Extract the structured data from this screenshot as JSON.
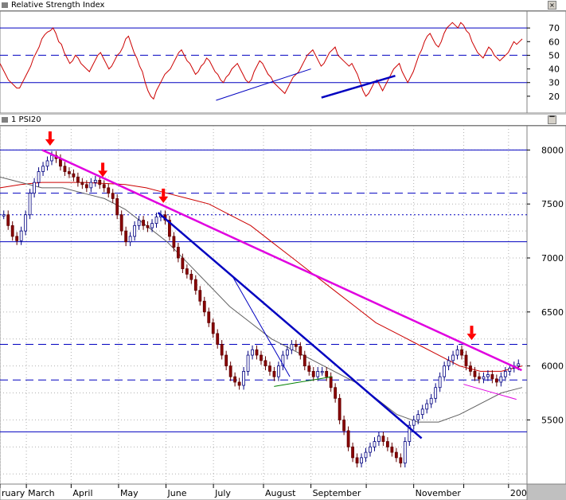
{
  "panes": {
    "rsi": {
      "title": "Relative Strength Index"
    },
    "price": {
      "title": "1 PSI20"
    }
  },
  "chart_data": [
    {
      "type": "line",
      "title": "Relative Strength Index",
      "ylim": [
        10,
        80
      ],
      "yticks": [
        20,
        30,
        40,
        50,
        60,
        70
      ],
      "hlines": [
        {
          "value": 70,
          "style": "solid",
          "color": "#0000c0"
        },
        {
          "value": 50,
          "style": "dashed",
          "color": "#0000c0"
        },
        {
          "value": 30,
          "style": "solid",
          "color": "#0000c0"
        }
      ],
      "series": [
        {
          "color": "#cc0000",
          "values": [
            44,
            40,
            36,
            32,
            30,
            28,
            26,
            26,
            30,
            34,
            38,
            42,
            48,
            52,
            56,
            62,
            65,
            67,
            68,
            70,
            66,
            60,
            58,
            52,
            48,
            44,
            46,
            50,
            48,
            44,
            42,
            40,
            38,
            42,
            46,
            50,
            52,
            48,
            44,
            40,
            42,
            46,
            50,
            52,
            56,
            62,
            64,
            58,
            52,
            48,
            42,
            38,
            30,
            24,
            20,
            18,
            24,
            28,
            32,
            36,
            38,
            40,
            44,
            48,
            52,
            54,
            50,
            46,
            44,
            40,
            36,
            38,
            42,
            44,
            48,
            46,
            42,
            38,
            36,
            32,
            30,
            34,
            36,
            40,
            42,
            44,
            40,
            36,
            32,
            30,
            32,
            38,
            42,
            46,
            44,
            40,
            36,
            34,
            30,
            28,
            26,
            24,
            22,
            26,
            30,
            34,
            36,
            38,
            42,
            46,
            50,
            52,
            54,
            50,
            46,
            42,
            44,
            48,
            52,
            54,
            56,
            50,
            48,
            46,
            44,
            42,
            44,
            40,
            36,
            30,
            24,
            20,
            22,
            26,
            30,
            32,
            28,
            24,
            28,
            32,
            36,
            40,
            42,
            44,
            38,
            34,
            30,
            34,
            38,
            44,
            50,
            54,
            60,
            64,
            66,
            62,
            58,
            56,
            60,
            66,
            70,
            72,
            74,
            72,
            70,
            74,
            72,
            68,
            66,
            60,
            56,
            52,
            50,
            48,
            52,
            56,
            54,
            50,
            48,
            46,
            48,
            50,
            52,
            56,
            60,
            58,
            60,
            62
          ]
        }
      ],
      "annotations": [
        {
          "kind": "trendline",
          "color": "#0000c0",
          "width": 1,
          "from": [
            0.41,
            17
          ],
          "to": [
            0.59,
            40
          ]
        },
        {
          "kind": "trendline",
          "color": "#0000c0",
          "width": 2.5,
          "from": [
            0.61,
            19
          ],
          "to": [
            0.75,
            35
          ]
        }
      ]
    },
    {
      "type": "candlestick",
      "title": "1 PSI20",
      "ylim": [
        4950,
        8180
      ],
      "yticks": [
        5500,
        6000,
        6500,
        7000,
        7500,
        8000
      ],
      "xticks": [
        "ruary",
        "March",
        "April",
        "May",
        "June",
        "July",
        "August",
        "September",
        "",
        "November",
        "",
        "200"
      ],
      "close": [
        7400,
        7300,
        7200,
        7160,
        7250,
        7400,
        7600,
        7700,
        7800,
        7850,
        7900,
        7950,
        7920,
        7850,
        7800,
        7780,
        7750,
        7700,
        7680,
        7650,
        7700,
        7720,
        7680,
        7650,
        7600,
        7550,
        7400,
        7250,
        7150,
        7200,
        7300,
        7350,
        7300,
        7280,
        7320,
        7380,
        7400,
        7350,
        7200,
        7100,
        7000,
        6900,
        6850,
        6800,
        6700,
        6600,
        6500,
        6400,
        6300,
        6200,
        6100,
        6000,
        5900,
        5850,
        5820,
        5950,
        6100,
        6150,
        6100,
        6050,
        6000,
        5950,
        5900,
        6000,
        6100,
        6150,
        6200,
        6180,
        6100,
        6000,
        5950,
        5900,
        5950,
        5950,
        5900,
        5800,
        5700,
        5500,
        5400,
        5250,
        5150,
        5100,
        5150,
        5200,
        5250,
        5300,
        5350,
        5300,
        5250,
        5200,
        5150,
        5100,
        5300,
        5450,
        5500,
        5550,
        5600,
        5650,
        5700,
        5800,
        5900,
        6000,
        6050,
        6100,
        6150,
        6100,
        6000,
        5950,
        5900,
        5880,
        5900,
        5920,
        5880,
        5850,
        5900,
        5950,
        5980,
        6000,
        6020
      ],
      "ma": [
        {
          "name": "",
          "color": "#cc0000",
          "values": [
            7650,
            7680,
            7700,
            7700,
            7700,
            7690,
            7680,
            7650,
            7600,
            7550,
            7500,
            7400,
            7300,
            7150,
            7000,
            6850,
            6700,
            6550,
            6400,
            6300,
            6200,
            6100,
            6000,
            5950,
            5950,
            6000
          ]
        },
        {
          "name": "",
          "color": "#606060",
          "values": [
            7750,
            7700,
            7650,
            7650,
            7600,
            7550,
            7450,
            7300,
            7150,
            6950,
            6750,
            6550,
            6400,
            6250,
            6150,
            6050,
            5950,
            5850,
            5700,
            5550,
            5480,
            5480,
            5550,
            5650,
            5750,
            5800
          ]
        }
      ],
      "hlines": [
        {
          "value": 8000,
          "style": "solid",
          "color": "#0000c0"
        },
        {
          "value": 7600,
          "style": "dashed",
          "color": "#0000c0"
        },
        {
          "value": 7400,
          "style": "dotted",
          "color": "#0000c0"
        },
        {
          "value": 7150,
          "style": "solid",
          "color": "#0000c0"
        },
        {
          "value": 6200,
          "style": "dashed",
          "color": "#0000c0"
        },
        {
          "value": 5870,
          "style": "dashed",
          "color": "#0000c0"
        },
        {
          "value": 5390,
          "style": "solid",
          "color": "#0000c0"
        }
      ],
      "trendlines": [
        {
          "color": "#e000e0",
          "width": 2.5,
          "from": [
            0.08,
            8000
          ],
          "to": [
            0.99,
            5960
          ]
        },
        {
          "color": "#0000c0",
          "width": 2.5,
          "from": [
            0.3,
            7420
          ],
          "to": [
            0.8,
            5330
          ]
        },
        {
          "color": "#0000c0",
          "width": 1,
          "from": [
            0.44,
            6840
          ],
          "to": [
            0.55,
            5900
          ]
        },
        {
          "color": "#e000e0",
          "width": 1,
          "from": [
            0.88,
            5830
          ],
          "to": [
            0.98,
            5690
          ]
        },
        {
          "color": "#008000",
          "width": 1,
          "from": [
            0.52,
            5810
          ],
          "to": [
            0.63,
            5900
          ]
        }
      ],
      "markers": [
        {
          "kind": "arrow-down",
          "color": "#ff0000",
          "at": [
            0.095,
            8010
          ]
        },
        {
          "kind": "arrow-down",
          "color": "#ff0000",
          "at": [
            0.195,
            7720
          ]
        },
        {
          "kind": "arrow-down",
          "color": "#ff0000",
          "at": [
            0.31,
            7480
          ]
        },
        {
          "kind": "arrow-down",
          "color": "#ff0000",
          "at": [
            0.895,
            6210
          ]
        }
      ]
    }
  ]
}
